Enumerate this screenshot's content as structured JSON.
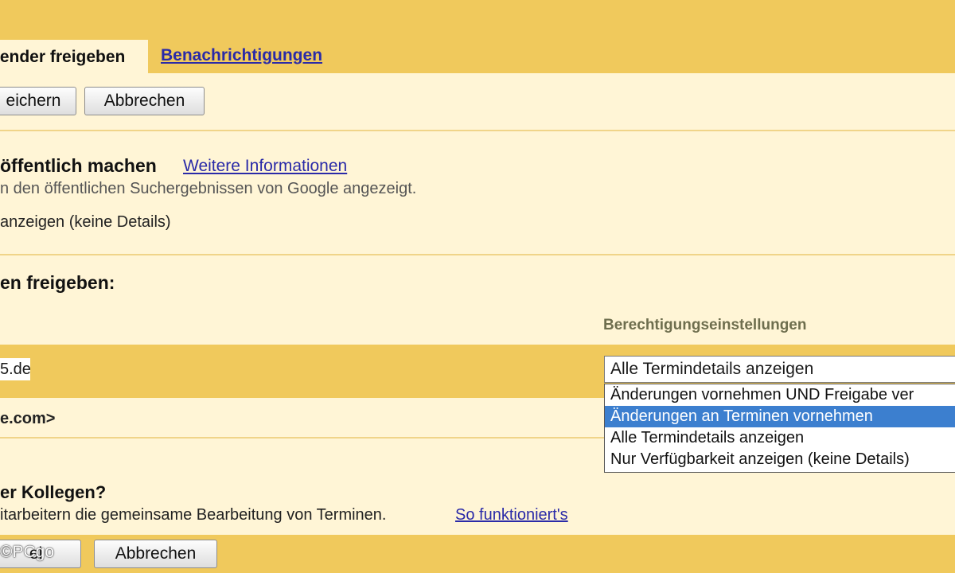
{
  "tabs": {
    "active_label": "lender freigeben",
    "link_label": "Benachrichtigungen"
  },
  "toolbar_top": {
    "save_label": "eichern",
    "cancel_label": "Abbrechen"
  },
  "public_section": {
    "heading": "öffentlich machen",
    "info_link": "Weitere Informationen",
    "description": "n den öffentlichen Suchergebnissen von Google angezeigt.",
    "option_label": "anzeigen (keine Details)"
  },
  "share_section": {
    "heading": "en freigeben:",
    "permission_header": "Berechtigungseinstellungen",
    "email_value": "5.de",
    "owner_row": "e.com>",
    "selected_permission": "Alle Termindetails anzeigen",
    "permission_options": [
      "Änderungen vornehmen UND Freigabe ver",
      "Änderungen an Terminen vornehmen",
      "Alle Termindetails anzeigen",
      "Nur Verfügbarkeit anzeigen (keine Details)"
    ],
    "highlighted_option_index": 1
  },
  "colleagues_section": {
    "heading": "er Kollegen?",
    "description": "itarbeitern die gemeinsame Bearbeitung von Terminen.",
    "howto_link": "So funktioniert's"
  },
  "toolbar_bottom": {
    "save_label": "ei",
    "cancel_label": "Abbrechen"
  },
  "watermark": "©PCgo",
  "colors": {
    "band": "#f0c95c",
    "background": "#fff5d6",
    "link": "#2a2aa8",
    "highlight": "#3c7fcf"
  }
}
